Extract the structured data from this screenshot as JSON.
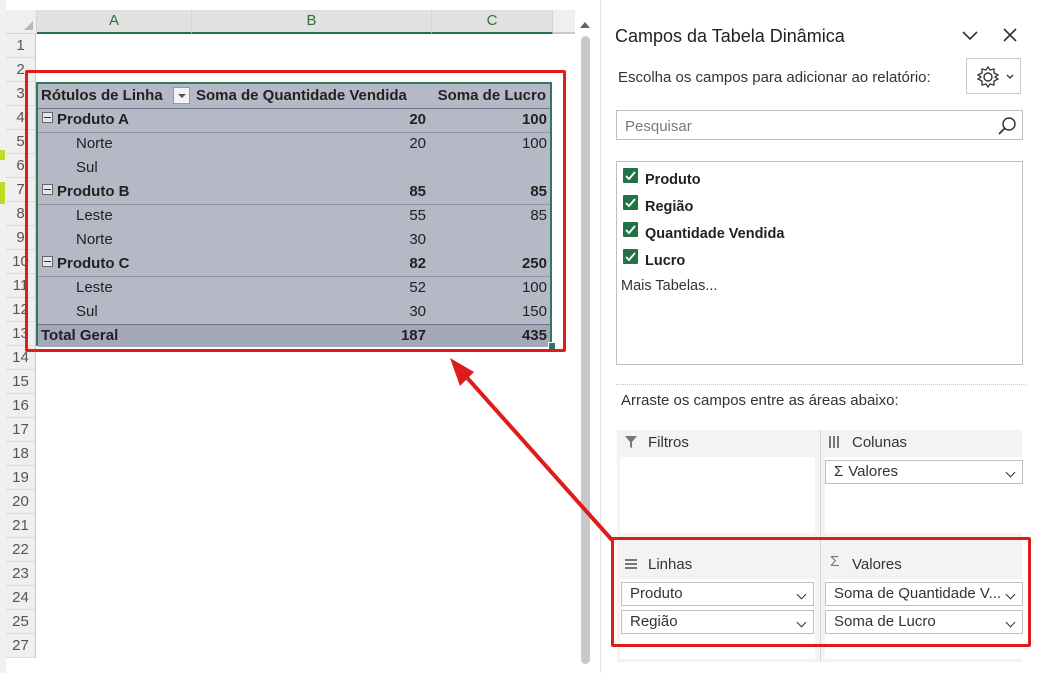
{
  "sheet": {
    "columns": [
      "A",
      "B",
      "C"
    ],
    "rows": [
      "1",
      "2",
      "3",
      "4",
      "5",
      "6",
      "7",
      "8",
      "9",
      "10",
      "11",
      "12",
      "13",
      "14",
      "15",
      "16",
      "17",
      "18",
      "19",
      "20",
      "21",
      "22",
      "23",
      "24",
      "25",
      "27"
    ]
  },
  "pivot": {
    "header": {
      "row_labels": "Rótulos de Linha",
      "qty": "Soma de Quantidade Vendida",
      "profit": "Soma de Lucro"
    },
    "rows": [
      {
        "label": "Produto A",
        "qty": "20",
        "profit": "100",
        "level": "group"
      },
      {
        "label": "Norte",
        "qty": "20",
        "profit": "100",
        "level": "item"
      },
      {
        "label": "Sul",
        "qty": "",
        "profit": "",
        "level": "item"
      },
      {
        "label": "Produto B",
        "qty": "85",
        "profit": "85",
        "level": "group"
      },
      {
        "label": "Leste",
        "qty": "55",
        "profit": "85",
        "level": "item"
      },
      {
        "label": "Norte",
        "qty": "30",
        "profit": "",
        "level": "item"
      },
      {
        "label": "Produto C",
        "qty": "82",
        "profit": "250",
        "level": "group"
      },
      {
        "label": "Leste",
        "qty": "52",
        "profit": "100",
        "level": "item"
      },
      {
        "label": "Sul",
        "qty": "30",
        "profit": "150",
        "level": "item"
      }
    ],
    "total": {
      "label": "Total Geral",
      "qty": "187",
      "profit": "435"
    }
  },
  "panel": {
    "title": "Campos da Tabela Dinâmica",
    "subtitle": "Escolha os campos para adicionar ao relatório:",
    "search_placeholder": "Pesquisar",
    "fields": [
      {
        "label": "Produto",
        "checked": true
      },
      {
        "label": "Região",
        "checked": true
      },
      {
        "label": "Quantidade Vendida",
        "checked": true
      },
      {
        "label": "Lucro",
        "checked": true
      }
    ],
    "more_tables": "Mais Tabelas...",
    "drag_hint": "Arraste os campos entre as áreas abaixo:",
    "areas": {
      "filters": {
        "label": "Filtros",
        "items": []
      },
      "columns": {
        "label": "Colunas",
        "items": [
          "Valores"
        ]
      },
      "rows": {
        "label": "Linhas",
        "items": [
          "Produto",
          "Região"
        ]
      },
      "values": {
        "label": "Valores",
        "items": [
          "Soma de Quantidade V...",
          "Soma de Lucro"
        ]
      }
    }
  },
  "colors": {
    "accent_green": "#217346",
    "highlight_red": "#dd1c1c",
    "pivot_fill": "#b4b9c5"
  }
}
